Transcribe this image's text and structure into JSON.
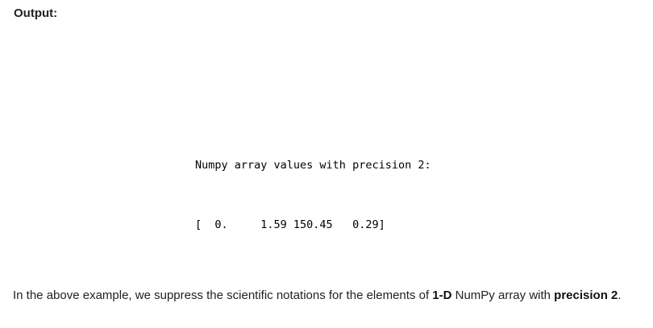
{
  "heading": "Output:",
  "code": {
    "line1": "Numpy array values with precision 2:",
    "line2": "[  0.     1.59 150.45   0.29]"
  },
  "description": {
    "part1": "In the above example, we suppress the scientific notations for the elements of ",
    "bold1": "1-D",
    "part2": " NumPy array with ",
    "bold2": "precision 2",
    "part3": "."
  }
}
